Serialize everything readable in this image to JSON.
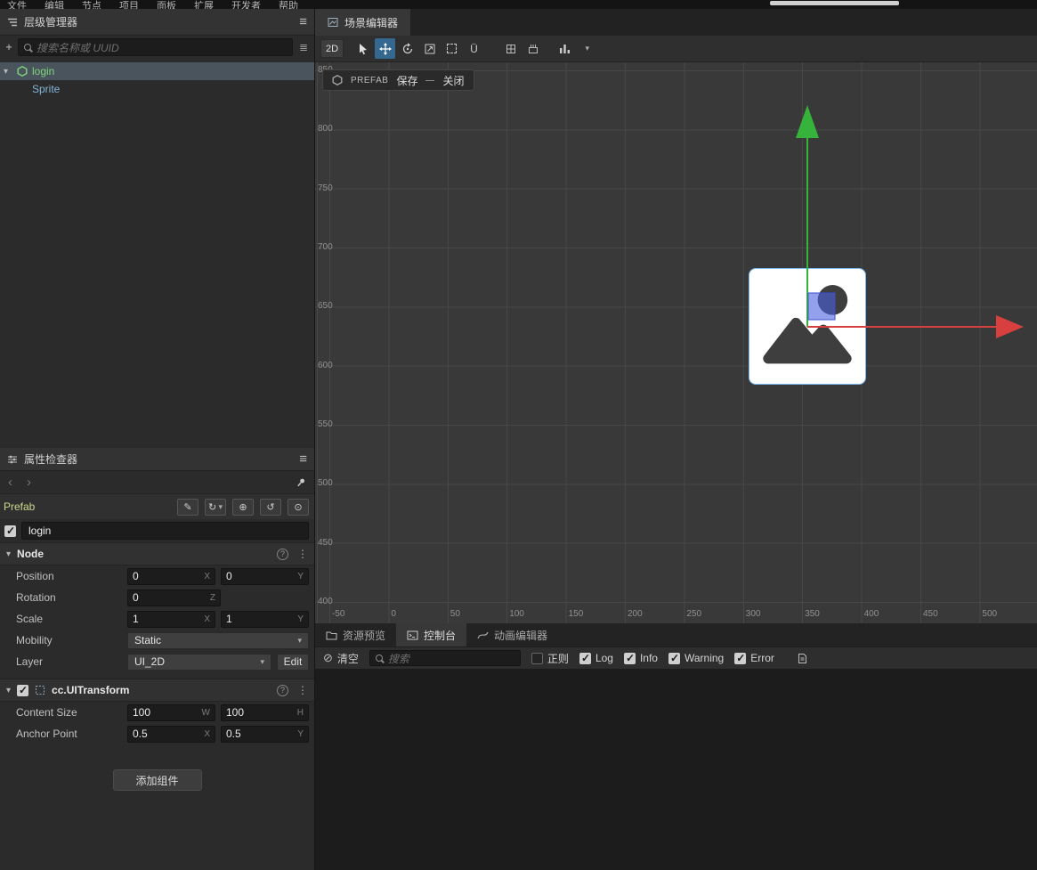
{
  "menu": [
    "文件",
    "编辑",
    "节点",
    "项目",
    "面板",
    "扩展",
    "开发者",
    "帮助"
  ],
  "hierarchy": {
    "title": "层级管理器",
    "search_placeholder": "搜索名称或 UUID",
    "root": "login",
    "child": "Sprite"
  },
  "inspector": {
    "title": "属性检查器",
    "prefab_label": "Prefab",
    "name_value": "login",
    "node_title": "Node",
    "position_label": "Position",
    "position_x": "0",
    "position_y": "0",
    "rotation_label": "Rotation",
    "rotation_z": "0",
    "scale_label": "Scale",
    "scale_x": "1",
    "scale_y": "1",
    "mobility_label": "Mobility",
    "mobility_value": "Static",
    "layer_label": "Layer",
    "layer_value": "UI_2D",
    "layer_edit": "Edit",
    "uitransform_title": "cc.UITransform",
    "content_size_label": "Content Size",
    "content_w": "100",
    "content_h": "100",
    "anchor_label": "Anchor Point",
    "anchor_x": "0.5",
    "anchor_y": "0.5",
    "add_component": "添加组件",
    "suffix": {
      "x": "X",
      "y": "Y",
      "z": "Z",
      "w": "W",
      "h": "H"
    }
  },
  "scene": {
    "tab_title": "场景编辑器",
    "mode2d": "2D",
    "prefab": {
      "tag": "PREFAB",
      "save": "保存",
      "close": "关闭"
    },
    "ruler_y": [
      "850",
      "800",
      "750",
      "700",
      "650",
      "600",
      "550",
      "500",
      "450",
      "400"
    ],
    "ruler_x": [
      "-50",
      "0",
      "50",
      "100",
      "150",
      "200",
      "250",
      "300",
      "350",
      "400",
      "450",
      "500"
    ]
  },
  "console": {
    "tab_assets": "资源预览",
    "tab_console": "控制台",
    "tab_anim": "动画编辑器",
    "clear": "清空",
    "search_placeholder": "搜索",
    "regex": "正则",
    "filters": [
      {
        "label": "Log",
        "checked": true
      },
      {
        "label": "Info",
        "checked": true
      },
      {
        "label": "Warning",
        "checked": true
      },
      {
        "label": "Error",
        "checked": true
      }
    ]
  },
  "colors": {
    "x_axis": "#d84040",
    "y_axis": "#35b33a",
    "plane_handle": "#4b63e0",
    "prefab_green": "#7ed67e",
    "child_blue": "#82b4d8",
    "tool_active": "#35688f",
    "select_row": "#4a545c"
  }
}
